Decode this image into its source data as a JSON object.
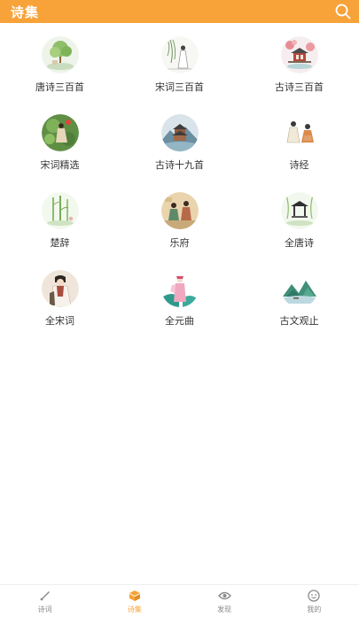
{
  "header": {
    "title": "诗集"
  },
  "colors": {
    "accent": "#f7a33a",
    "text": "#333333",
    "nav_inactive": "#8a8a8a"
  },
  "collections": [
    {
      "label": "唐诗三百首",
      "icon": "landscape-tree-icon"
    },
    {
      "label": "宋词三百首",
      "icon": "willow-scholar-icon"
    },
    {
      "label": "古诗三百首",
      "icon": "pavilion-blossom-icon"
    },
    {
      "label": "宋词精选",
      "icon": "scholar-garden-icon"
    },
    {
      "label": "古诗十九首",
      "icon": "pagoda-mountain-icon"
    },
    {
      "label": "诗经",
      "icon": "two-figures-icon"
    },
    {
      "label": "楚辞",
      "icon": "bamboo-icon"
    },
    {
      "label": "乐府",
      "icon": "courtyard-figures-icon"
    },
    {
      "label": "全唐诗",
      "icon": "pavilion-willow-icon"
    },
    {
      "label": "全宋词",
      "icon": "lady-portrait-icon"
    },
    {
      "label": "全元曲",
      "icon": "opera-figure-icon"
    },
    {
      "label": "古文观止",
      "icon": "green-mountains-icon"
    }
  ],
  "bottom_nav": [
    {
      "label": "诗词",
      "icon": "brush-icon",
      "active": false
    },
    {
      "label": "诗集",
      "icon": "book-icon",
      "active": true
    },
    {
      "label": "发现",
      "icon": "eye-icon",
      "active": false
    },
    {
      "label": "我的",
      "icon": "smiley-icon",
      "active": false
    }
  ]
}
